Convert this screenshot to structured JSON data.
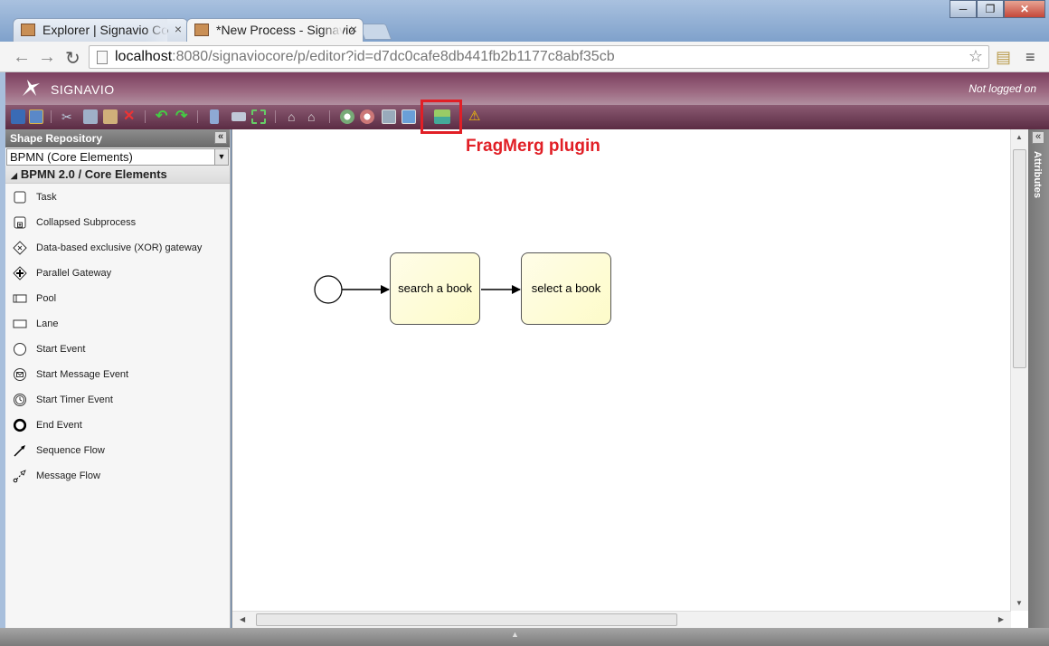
{
  "browser": {
    "tabs": [
      {
        "label": "Explorer | Signavio Co",
        "active": false
      },
      {
        "label": "*New Process - Signavio",
        "active": true
      }
    ],
    "address": {
      "host": "localhost",
      "path": ":8080/signaviocore/p/editor?id=d7dc0cafe8db441fb2b1177c8abf35cb"
    },
    "window_buttons": {
      "minimize": "─",
      "maximize": "❐",
      "close": "✕"
    }
  },
  "app": {
    "brand": "SIGNAVIO",
    "login_status": "Not logged on",
    "annotation": "FragMerg plugin"
  },
  "shape_repository": {
    "title": "Shape Repository",
    "collapse_glyph": "«",
    "selected_set": "BPMN (Core Elements)",
    "group_title": "BPMN 2.0 / Core Elements",
    "items": [
      {
        "label": "Task",
        "icon": "task-icon"
      },
      {
        "label": "Collapsed Subprocess",
        "icon": "subprocess-icon"
      },
      {
        "label": "Data-based exclusive (XOR) gateway",
        "icon": "xor-gateway-icon"
      },
      {
        "label": "Parallel Gateway",
        "icon": "parallel-gateway-icon"
      },
      {
        "label": "Pool",
        "icon": "pool-icon"
      },
      {
        "label": "Lane",
        "icon": "lane-icon"
      },
      {
        "label": "Start Event",
        "icon": "start-event-icon"
      },
      {
        "label": "Start Message Event",
        "icon": "start-message-event-icon"
      },
      {
        "label": "Start Timer Event",
        "icon": "start-timer-event-icon"
      },
      {
        "label": "End Event",
        "icon": "end-event-icon"
      },
      {
        "label": "Sequence Flow",
        "icon": "sequence-flow-icon"
      },
      {
        "label": "Message Flow",
        "icon": "message-flow-icon"
      }
    ]
  },
  "diagram": {
    "tasks": [
      {
        "label": "search a book"
      },
      {
        "label": "select a book"
      }
    ]
  },
  "attributes_panel": {
    "title": "Attributes",
    "collapse_glyph": "«"
  },
  "colors": {
    "header": "#7b3f5f",
    "annotation": "#e11f26",
    "task_fill": "#fdfbc9"
  }
}
